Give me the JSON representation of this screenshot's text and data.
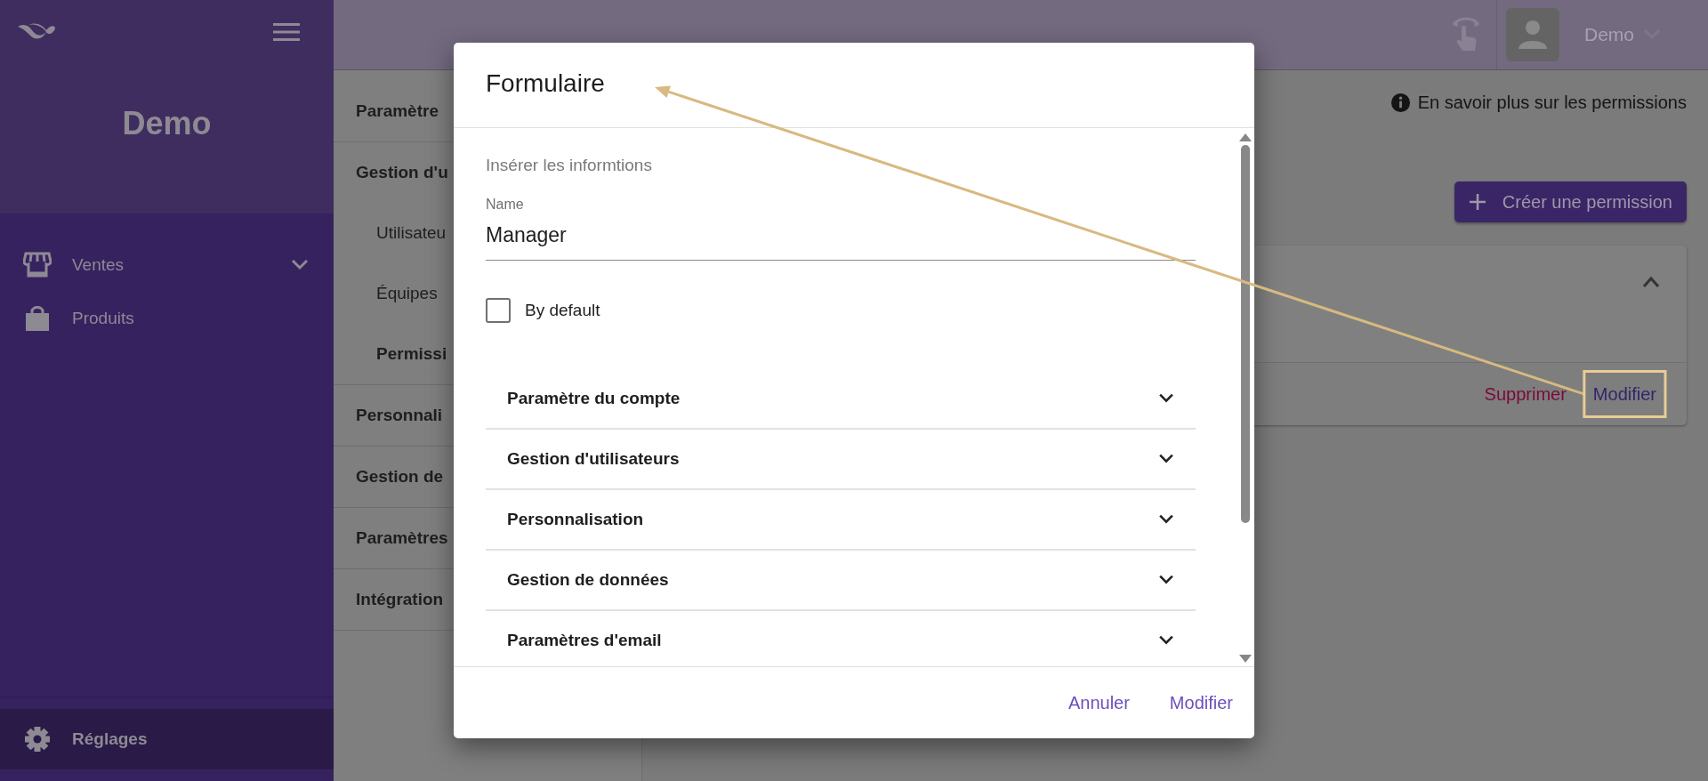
{
  "sidebar": {
    "title": "Demo",
    "items": [
      {
        "label": "Ventes",
        "kind": "group"
      },
      {
        "label": "Produits",
        "kind": "link"
      }
    ],
    "footer_item": {
      "label": "Réglages",
      "selected": true
    }
  },
  "header": {
    "user": "Demo"
  },
  "settings_nav": {
    "items": [
      {
        "label": "Paramètre",
        "selected": false
      },
      {
        "label": "Gestion d'u",
        "selected": false,
        "children": [
          {
            "label": "Utilisateu",
            "selected": false
          },
          {
            "label": "Équipes",
            "selected": false
          },
          {
            "label": "Permissi",
            "selected": true
          }
        ]
      },
      {
        "label": "Personnali",
        "selected": false
      },
      {
        "label": "Gestion de",
        "selected": false
      },
      {
        "label": "Paramètres",
        "selected": false
      },
      {
        "label": "Intégration",
        "selected": false
      }
    ]
  },
  "content": {
    "info_link": "En savoir plus sur les permissions",
    "create_button": "Créer une permission",
    "card": {
      "expanded": true,
      "actions": [
        {
          "label": "Supprimer",
          "kind": "danger"
        },
        {
          "label": "Modifier",
          "kind": "primary"
        }
      ]
    }
  },
  "dialog": {
    "title": "Formulaire",
    "subtitle": "Insérer les informtions",
    "field": {
      "label": "Name",
      "value": "Manager"
    },
    "checkbox": {
      "label": "By default",
      "checked": false
    },
    "sections": [
      {
        "label": "Paramètre du compte",
        "expanded": false
      },
      {
        "label": "Gestion d'utilisateurs",
        "expanded": false
      },
      {
        "label": "Personnalisation",
        "expanded": false
      },
      {
        "label": "Gestion de données",
        "expanded": false
      },
      {
        "label": "Paramètres d'email",
        "expanded": false
      }
    ],
    "buttons": [
      "Annuler",
      "Modifier"
    ]
  }
}
